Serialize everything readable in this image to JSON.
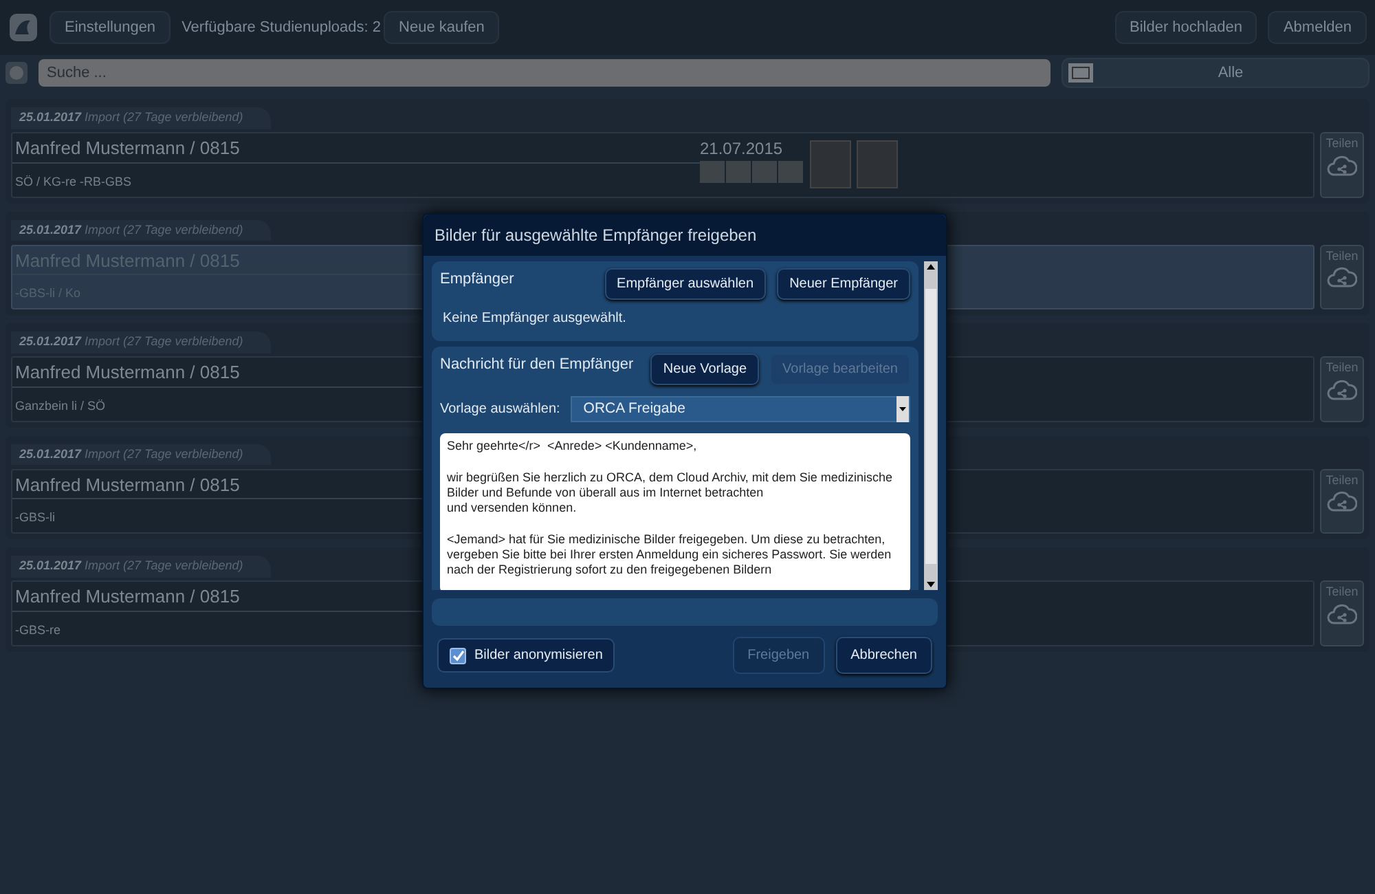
{
  "topbar": {
    "settings_button": "Einstellungen",
    "uploads_label": "Verfügbare Studienuploads: 2",
    "buy_button": "Neue kaufen",
    "upload_button": "Bilder hochladen",
    "logout_button": "Abmelden"
  },
  "search": {
    "placeholder": "Suche ...",
    "filter": "Alle"
  },
  "studies": [
    {
      "header": "**25.01.2017** Import (27 Tage verbleibend)",
      "patient": "Manfred Mustermann / 0815",
      "description": "SÖ / KG-re -RB-GBS",
      "selected": false,
      "series_date": "21.07.2015",
      "share_button": "Teilen"
    },
    {
      "header": "**25.01.2017** Import (27 Tage verbleibend)",
      "patient": "Manfred Mustermann / 0815",
      "description": "-GBS-li / Ko",
      "selected": true,
      "share_button": "Teilen"
    },
    {
      "header": "**25.01.2017** Import (27 Tage verbleibend)",
      "patient": "Manfred Mustermann / 0815",
      "description": "Ganzbein li / SÖ",
      "selected": false,
      "share_button": "Teilen"
    },
    {
      "header": "**25.01.2017** Import (27 Tage verbleibend)",
      "patient": "Manfred Mustermann / 0815",
      "description": "-GBS-li",
      "selected": false,
      "share_button": "Teilen"
    },
    {
      "header": "**25.01.2017** Import (27 Tage verbleibend)",
      "patient": "Manfred Mustermann / 0815",
      "description": "-GBS-re",
      "selected": false,
      "share_button": "Teilen"
    }
  ],
  "dialog": {
    "title": "Bilder für ausgewählte Empfänger freigeben",
    "recipients": {
      "heading": "Empfänger",
      "select_button": "Empfänger auswählen",
      "new_button": "Neuer Empfänger",
      "empty_text": "Keine Empfänger ausgewählt."
    },
    "message": {
      "heading": "Nachricht für den Empfänger",
      "new_template_button": {
        "label": "Neue Vorlage",
        "disabled": false
      },
      "edit_template_button": {
        "label": "Vorlage bearbeiten",
        "disabled": true
      },
      "template_label": "Vorlage auswählen:",
      "template_value": "ORCA Freigabe",
      "text": "Sehr geehrte</r>  <Anrede> <Kundenname>,\n\nwir begrüßen Sie herzlich zu ORCA, dem Cloud Archiv, mit dem Sie medizinische Bilder und Befunde von überall aus im Internet betrachten\nund versenden können.\n\n<Jemand> hat für Sie medizinische Bilder freigegeben. Um diese zu betrachten, vergeben Sie bitte bei Ihrer ersten Anmeldung ein sicheres Passwort. Sie werden nach der Registrierung sofort zu den freigegebenen Bildern"
    },
    "anonymize": {
      "label": "Bilder anonymisieren",
      "checked": true
    },
    "share_button": {
      "label": "Freigeben",
      "disabled": true
    },
    "cancel_button": {
      "label": "Abbrechen",
      "disabled": false
    }
  }
}
